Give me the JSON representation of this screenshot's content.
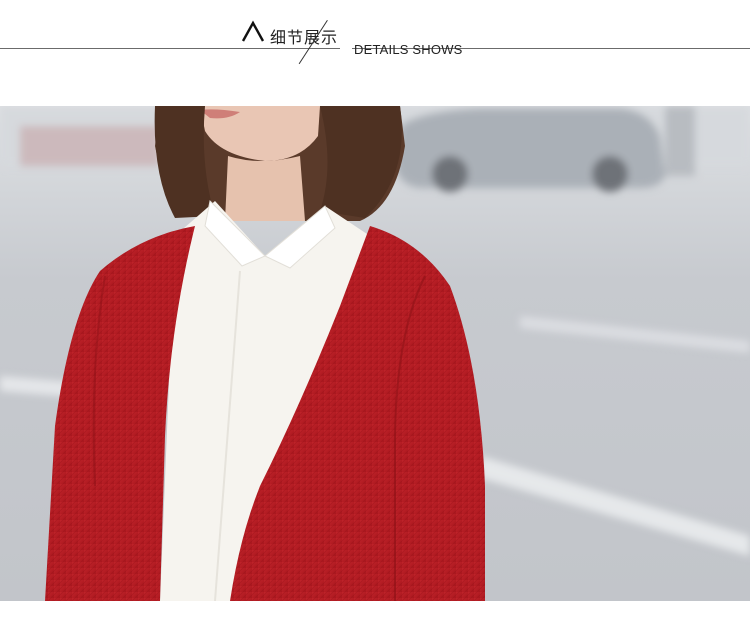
{
  "header": {
    "cn_title": "细节展示",
    "en_title": "DETAILS SHOWS",
    "caret_icon": "caret-up-icon"
  },
  "photo": {
    "subject": "product-detail-photo",
    "colors": {
      "cardigan": "#b51c22",
      "shirt": "#f6f4ef",
      "hair": "#5a3a2a",
      "road": "#c8cbcf",
      "car": "#a9aeb5"
    }
  }
}
